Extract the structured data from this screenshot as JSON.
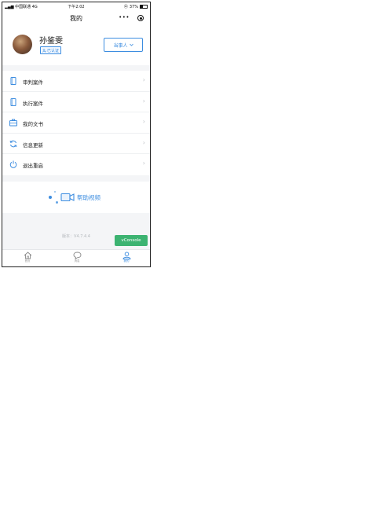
{
  "status_bar": {
    "carrier": "中国联通",
    "network": "4G",
    "time": "下午2:02",
    "battery": "37%"
  },
  "nav": {
    "title": "我的",
    "more_icon": "more-dots-icon",
    "target_icon": "target-icon"
  },
  "profile": {
    "name": "孙鉴雯",
    "verified_label": "已认证",
    "role_button": "当事人"
  },
  "menu": [
    {
      "label": "审判案件",
      "icon": "document-icon"
    },
    {
      "label": "执行案件",
      "icon": "document-icon"
    },
    {
      "label": "我的文书",
      "icon": "briefcase-icon"
    },
    {
      "label": "信息更新",
      "icon": "refresh-icon"
    },
    {
      "label": "退出重启",
      "icon": "power-icon"
    }
  ],
  "help": {
    "label": "帮助视频",
    "icon": "video-camera-icon"
  },
  "version": "版本：V4.7.4.4",
  "vconsole": "vConsole",
  "tabbar": [
    {
      "label": "首页",
      "icon": "home-icon"
    },
    {
      "label": "消息",
      "icon": "chat-bubble-icon"
    },
    {
      "label": "我的",
      "icon": "user-icon",
      "active": true
    }
  ],
  "colors": {
    "accent": "#3d8de0",
    "vconsole_green": "#3cb371",
    "background": "#f4f5f7"
  }
}
